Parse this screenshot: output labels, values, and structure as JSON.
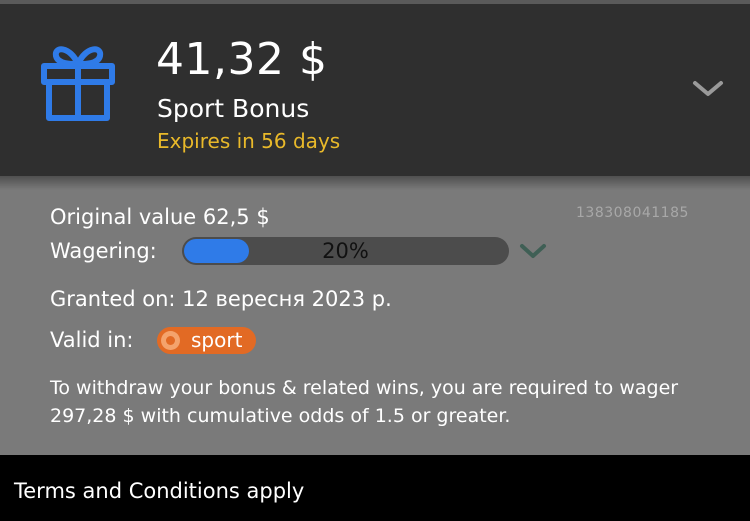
{
  "header": {
    "icon": "gift-icon",
    "amount": "41,32 $",
    "bonus_name": "Sport Bonus",
    "expires": "Expires in 56 days",
    "expand_icon": "chevron-down-icon"
  },
  "details": {
    "reference_id": "138308041185",
    "original_value": "Original value 62,5 $",
    "wagering_label": "Wagering:",
    "wagering_progress": 0.2,
    "wagering_progress_text": "20%",
    "granted_on": "Granted on: 12 вересня 2023 р.",
    "valid_in_label": "Valid in:",
    "valid_in_badge": "sport",
    "requirement_text": "To withdraw your bonus & related wins, you are required to wager 297,28 $ with cumulative odds of 1.5 or greater."
  },
  "footer": {
    "terms_text": "Terms and Conditions apply"
  },
  "colors": {
    "header_bg": "#2f2f2f",
    "body_bg": "#7a7a7a",
    "expires": "#e9b92a",
    "accent_blue": "#2f7be8",
    "badge_orange": "#e26a24"
  }
}
